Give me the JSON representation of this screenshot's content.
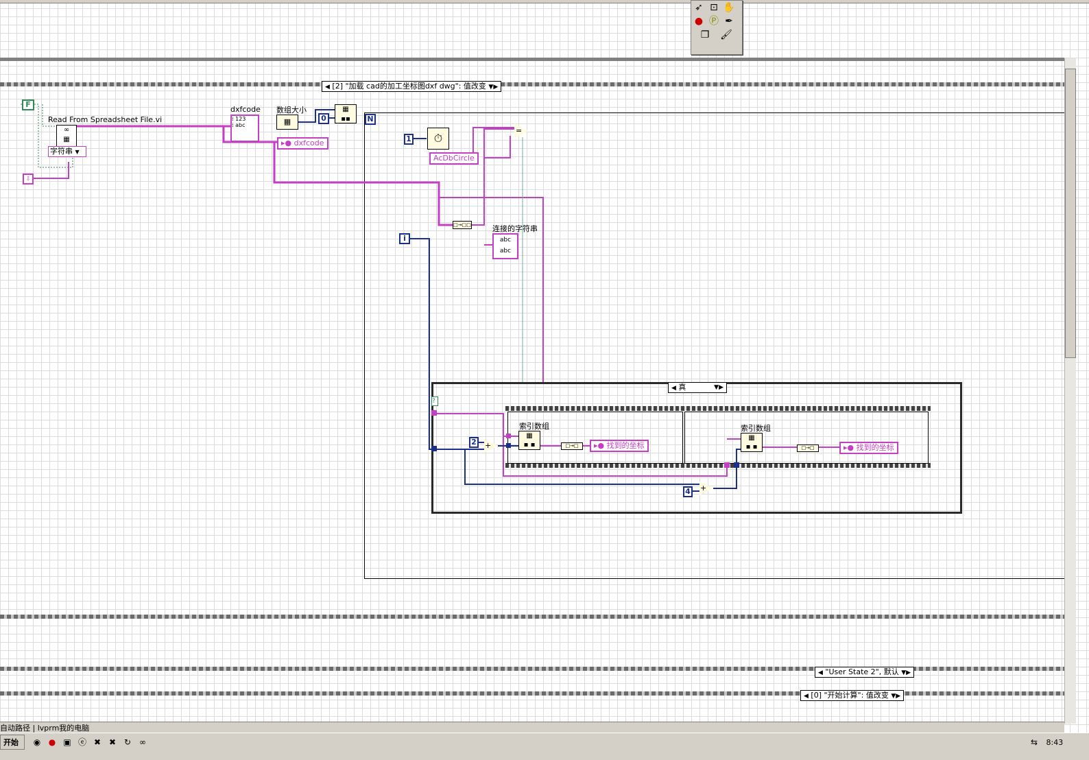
{
  "toolbar": {},
  "tools_palette": {
    "tools": [
      "operate-value-icon",
      "position-size-icon",
      "hand-icon",
      "breakpoint-icon",
      "probe-icon",
      "color-copy-icon",
      "color-fg-bg-icon",
      "brush-icon"
    ]
  },
  "outer_event_structure": {
    "case_label": "[2] \"加载 cad的加工坐标图dxf dwg\": 值改变"
  },
  "bool_constant": "F",
  "read_vi": {
    "title": "Read From Spreadsheet File.vi",
    "format_selector": "字符串"
  },
  "dxfcode_control": {
    "label": "dxfcode"
  },
  "array_size": {
    "label": "数组大小"
  },
  "dxfcode_indicator": {
    "label": "dxfcode"
  },
  "const_zero": "0",
  "loop_N": "N",
  "const_one": "1",
  "acdbcircle": "AcDbCircle",
  "concat_label": "连接的字符串",
  "loop_i": "i",
  "case_structure": {
    "selector": "真"
  },
  "case_true_icon": "?",
  "const_two": "2",
  "const_four": "4",
  "frame1": {
    "index_label": "索引数组",
    "indicator": "找到的坐标"
  },
  "frame2": {
    "index_label": "索引数组",
    "indicator": "找到的坐标"
  },
  "user_state_case": {
    "label": "\"User State 2\", 默认"
  },
  "start_calc_case": {
    "label": "[0] \"开始计算\": 值改变"
  },
  "status_bar": {
    "path": "自动路径 | lvprm我的电脑"
  },
  "taskbar": {
    "start": "开始",
    "clock": "8:43"
  },
  "colors": {
    "string_wire": "#c33fc3",
    "int_wire": "#1a2f8c",
    "frame": "#2a2a2a",
    "grid": "#dcdcdc"
  }
}
